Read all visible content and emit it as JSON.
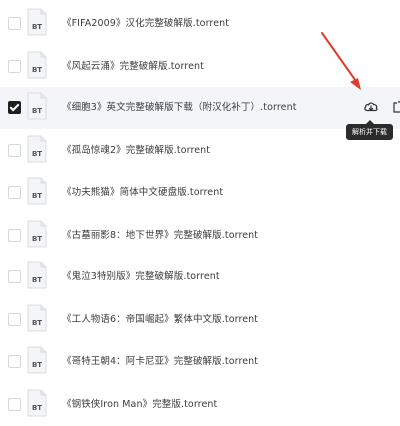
{
  "colors": {
    "accent_arrow": "#e03a2f",
    "selected_row_bg": "#f3f5f8",
    "checkbox_checked": "#1f1f1f",
    "tooltip_bg": "#2b2b2b"
  },
  "file_icon_label": "BT",
  "files": [
    {
      "name": "《FIFA2009》汉化完整破解版.torrent",
      "selected": false
    },
    {
      "name": "《风起云涌》完整破解版.torrent",
      "selected": false
    },
    {
      "name": "《细胞3》英文完整破解版下载（附汉化补丁）.torrent",
      "selected": true
    },
    {
      "name": "《孤岛惊魂2》完整破解版.torrent",
      "selected": false
    },
    {
      "name": "《功夫熊猫》简体中文硬盘版.torrent",
      "selected": false
    },
    {
      "name": "《古墓丽影8：地下世界》完整破解版.torrent",
      "selected": false
    },
    {
      "name": "《鬼泣3特别版》完整破解版.torrent",
      "selected": false
    },
    {
      "name": "《工人物语6：帝国崛起》繁体中文版.torrent",
      "selected": false
    },
    {
      "name": "《哥特王朝4：阿卡尼亚》完整破解版.torrent",
      "selected": false
    },
    {
      "name": "《钢铁侠Iron Man》完整版.torrent",
      "selected": false
    }
  ],
  "row_actions": {
    "download_icon": "cloud-download-icon",
    "share_icon": "share-icon",
    "tooltip": "解析并下载"
  }
}
